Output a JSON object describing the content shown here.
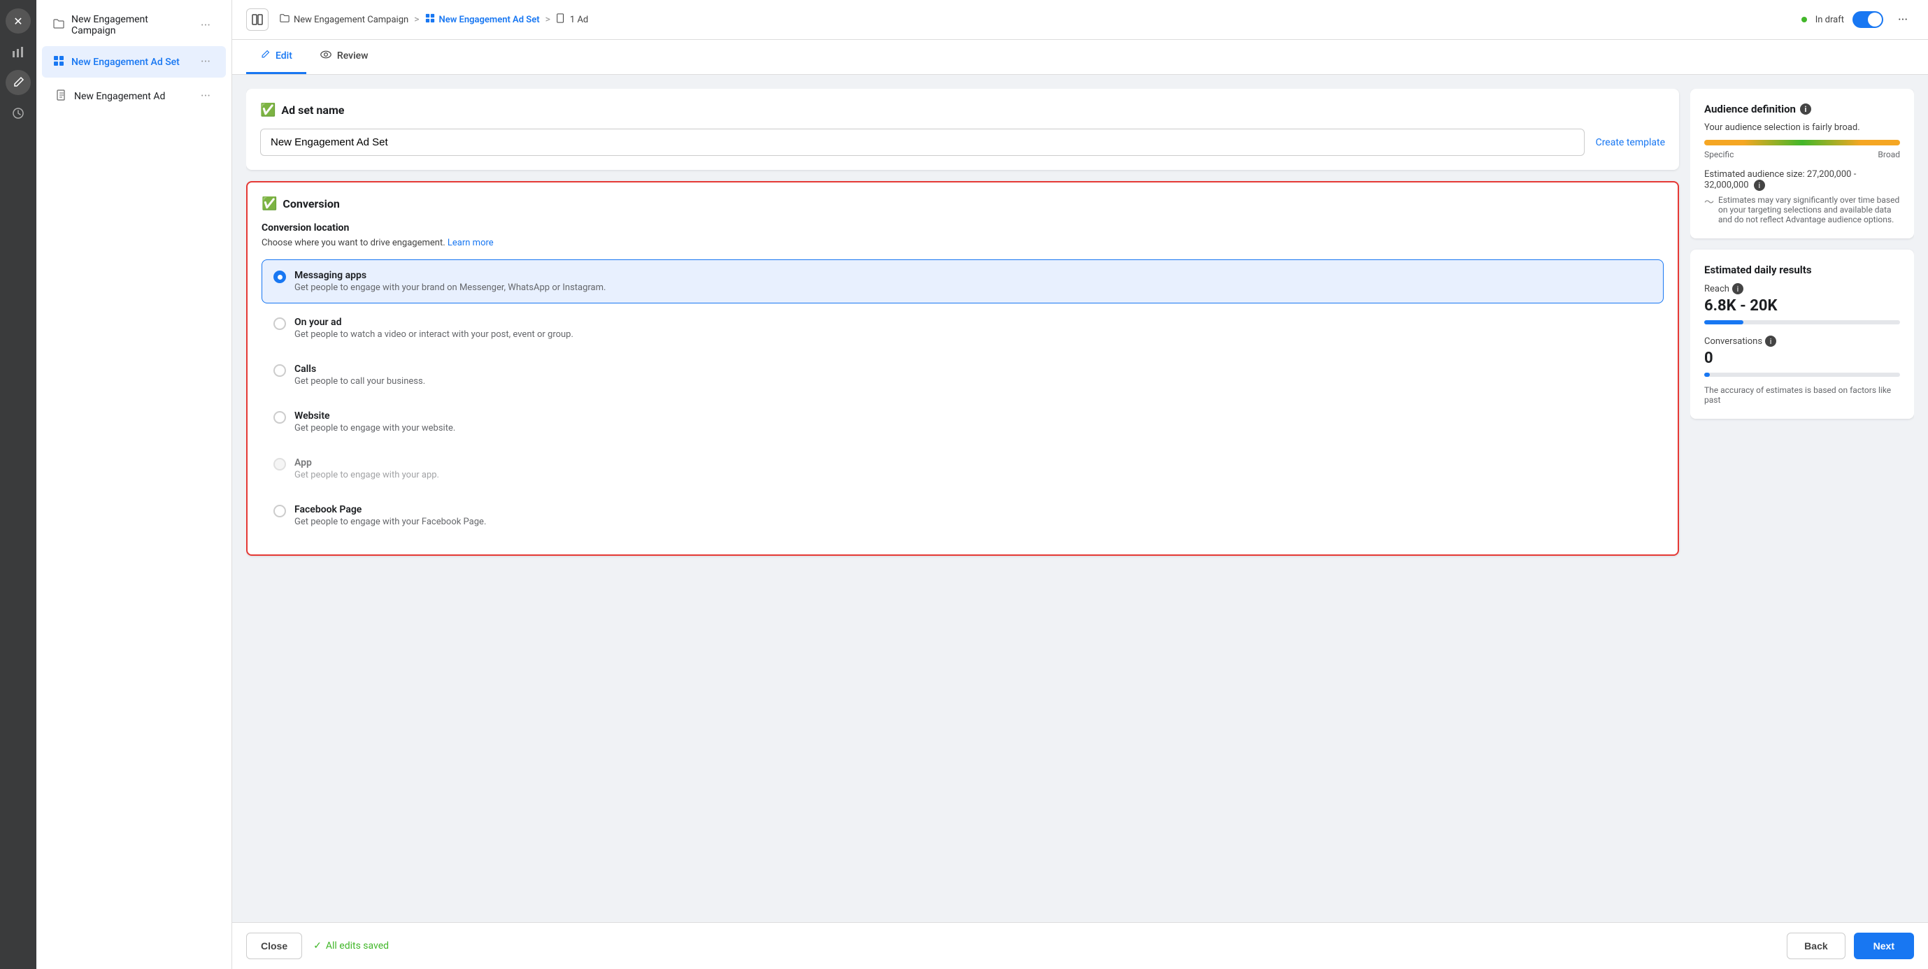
{
  "sidebar_icons": [
    {
      "name": "close-icon",
      "symbol": "✕"
    },
    {
      "name": "chart-icon",
      "symbol": "📊"
    },
    {
      "name": "edit-icon",
      "symbol": "✏️"
    },
    {
      "name": "clock-icon",
      "symbol": "🕐"
    }
  ],
  "nav": {
    "items": [
      {
        "id": "campaign",
        "icon": "📁",
        "icon_type": "folder",
        "label": "New Engagement Campaign",
        "active": false
      },
      {
        "id": "adset",
        "icon": "⊞",
        "icon_type": "grid",
        "label": "New Engagement Ad Set",
        "active": true
      },
      {
        "id": "ad",
        "icon": "📄",
        "icon_type": "file",
        "label": "New Engagement Ad",
        "active": false,
        "indent": true
      }
    ]
  },
  "breadcrumb": {
    "toggle_icon": "⊟",
    "items": [
      {
        "label": "New Engagement Campaign",
        "icon": "📁",
        "active": false
      },
      {
        "sep": ">"
      },
      {
        "label": "New Engagement Ad Set",
        "icon": "⊞",
        "active": true
      },
      {
        "sep": ">"
      },
      {
        "label": "1 Ad",
        "icon": "📄",
        "active": false
      }
    ],
    "status_label": "In draft",
    "more_icon": "•••"
  },
  "tabs": {
    "edit_label": "Edit",
    "edit_icon": "✏️",
    "review_label": "Review",
    "review_icon": "👁"
  },
  "adset_name_section": {
    "title": "Ad set name",
    "check_icon": "✓",
    "input_value": "New Engagement Ad Set",
    "input_placeholder": "New Engagement Ad Set",
    "create_template_label": "Create template"
  },
  "conversion_section": {
    "title": "Conversion",
    "check_icon": "✓",
    "section_label": "Conversion location",
    "description": "Choose where you want to drive engagement.",
    "learn_more_label": "Learn more",
    "options": [
      {
        "id": "messaging",
        "label": "Messaging apps",
        "desc": "Get people to engage with your brand on Messenger, WhatsApp or Instagram.",
        "selected": true,
        "disabled": false
      },
      {
        "id": "on_ad",
        "label": "On your ad",
        "desc": "Get people to watch a video or interact with your post, event or group.",
        "selected": false,
        "disabled": false
      },
      {
        "id": "calls",
        "label": "Calls",
        "desc": "Get people to call your business.",
        "selected": false,
        "disabled": false
      },
      {
        "id": "website",
        "label": "Website",
        "desc": "Get people to engage with your website.",
        "selected": false,
        "disabled": false
      },
      {
        "id": "app",
        "label": "App",
        "desc": "Get people to engage with your app.",
        "selected": false,
        "disabled": true
      },
      {
        "id": "facebook_page",
        "label": "Facebook Page",
        "desc": "Get people to engage with your Facebook Page.",
        "selected": false,
        "disabled": false
      }
    ]
  },
  "audience_definition": {
    "title": "Audience definition",
    "info_icon": "i",
    "desc": "Your audience selection is fairly broad.",
    "meter_label_left": "Specific",
    "meter_label_right": "Broad",
    "size_label": "Estimated audience size: 27,200,000 - 32,000,000",
    "note": "Estimates may vary significantly over time based on your targeting selections and available data and do not reflect Advantage audience options."
  },
  "daily_results": {
    "title": "Estimated daily results",
    "reach_label": "Reach",
    "reach_value": "6.8K - 20K",
    "reach_bar_pct": 20,
    "conversations_label": "Conversations",
    "conversations_value": "0",
    "conv_bar_pct": 3,
    "accuracy_note": "The accuracy of estimates is based on factors like past"
  },
  "bottom_bar": {
    "close_label": "Close",
    "saved_label": "All edits saved",
    "back_label": "Back",
    "next_label": "Next"
  }
}
